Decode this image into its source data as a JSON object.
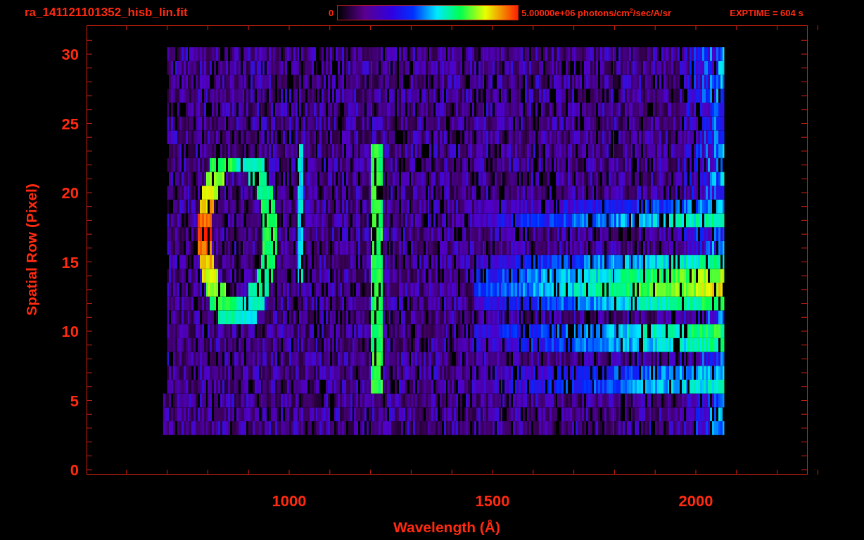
{
  "plot": {
    "title": "ra_141121101352_hisb_lin.fit",
    "colorbar": {
      "min_label": "0",
      "max_label": "5.00000e+06 photons/cm$^{2}$/sec/A/sr"
    },
    "exposure": "EXPTIME = 604 s",
    "xlabel": "Wavelength (Å)",
    "ylabel": "Spatial Row (Pixel)",
    "xticks": [
      "1000",
      "1500",
      "2000"
    ],
    "yticks": [
      "30",
      "25",
      "20",
      "15",
      "10",
      "5",
      "0"
    ]
  }
}
